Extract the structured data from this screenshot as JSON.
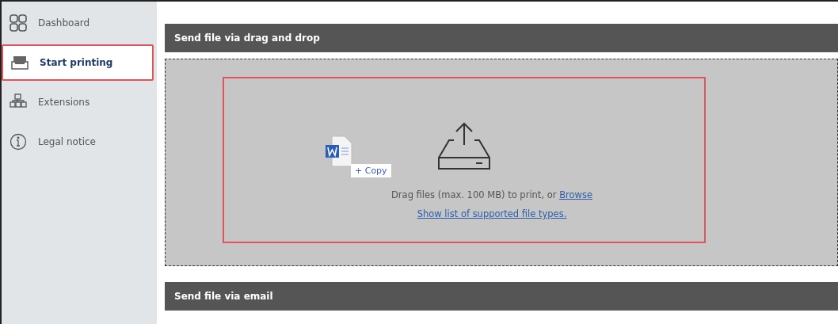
{
  "sidebar": {
    "items": [
      {
        "label": "Dashboard",
        "selected": false,
        "highlighted": false
      },
      {
        "label": "Start printing",
        "selected": true,
        "highlighted": true
      },
      {
        "label": "Extensions",
        "selected": false,
        "highlighted": false
      },
      {
        "label": "Legal notice",
        "selected": false,
        "highlighted": false
      }
    ]
  },
  "sections": [
    {
      "title": "Send file via drag and drop",
      "drop_zone": {
        "highlighted": true,
        "drag_badge": "+ Copy",
        "text": "Drag files (max. 100 MB) to print, or ",
        "browse_link": "Browse",
        "types_link": "Show list of supported file types."
      }
    },
    {
      "title": "Send file via email"
    }
  ]
}
